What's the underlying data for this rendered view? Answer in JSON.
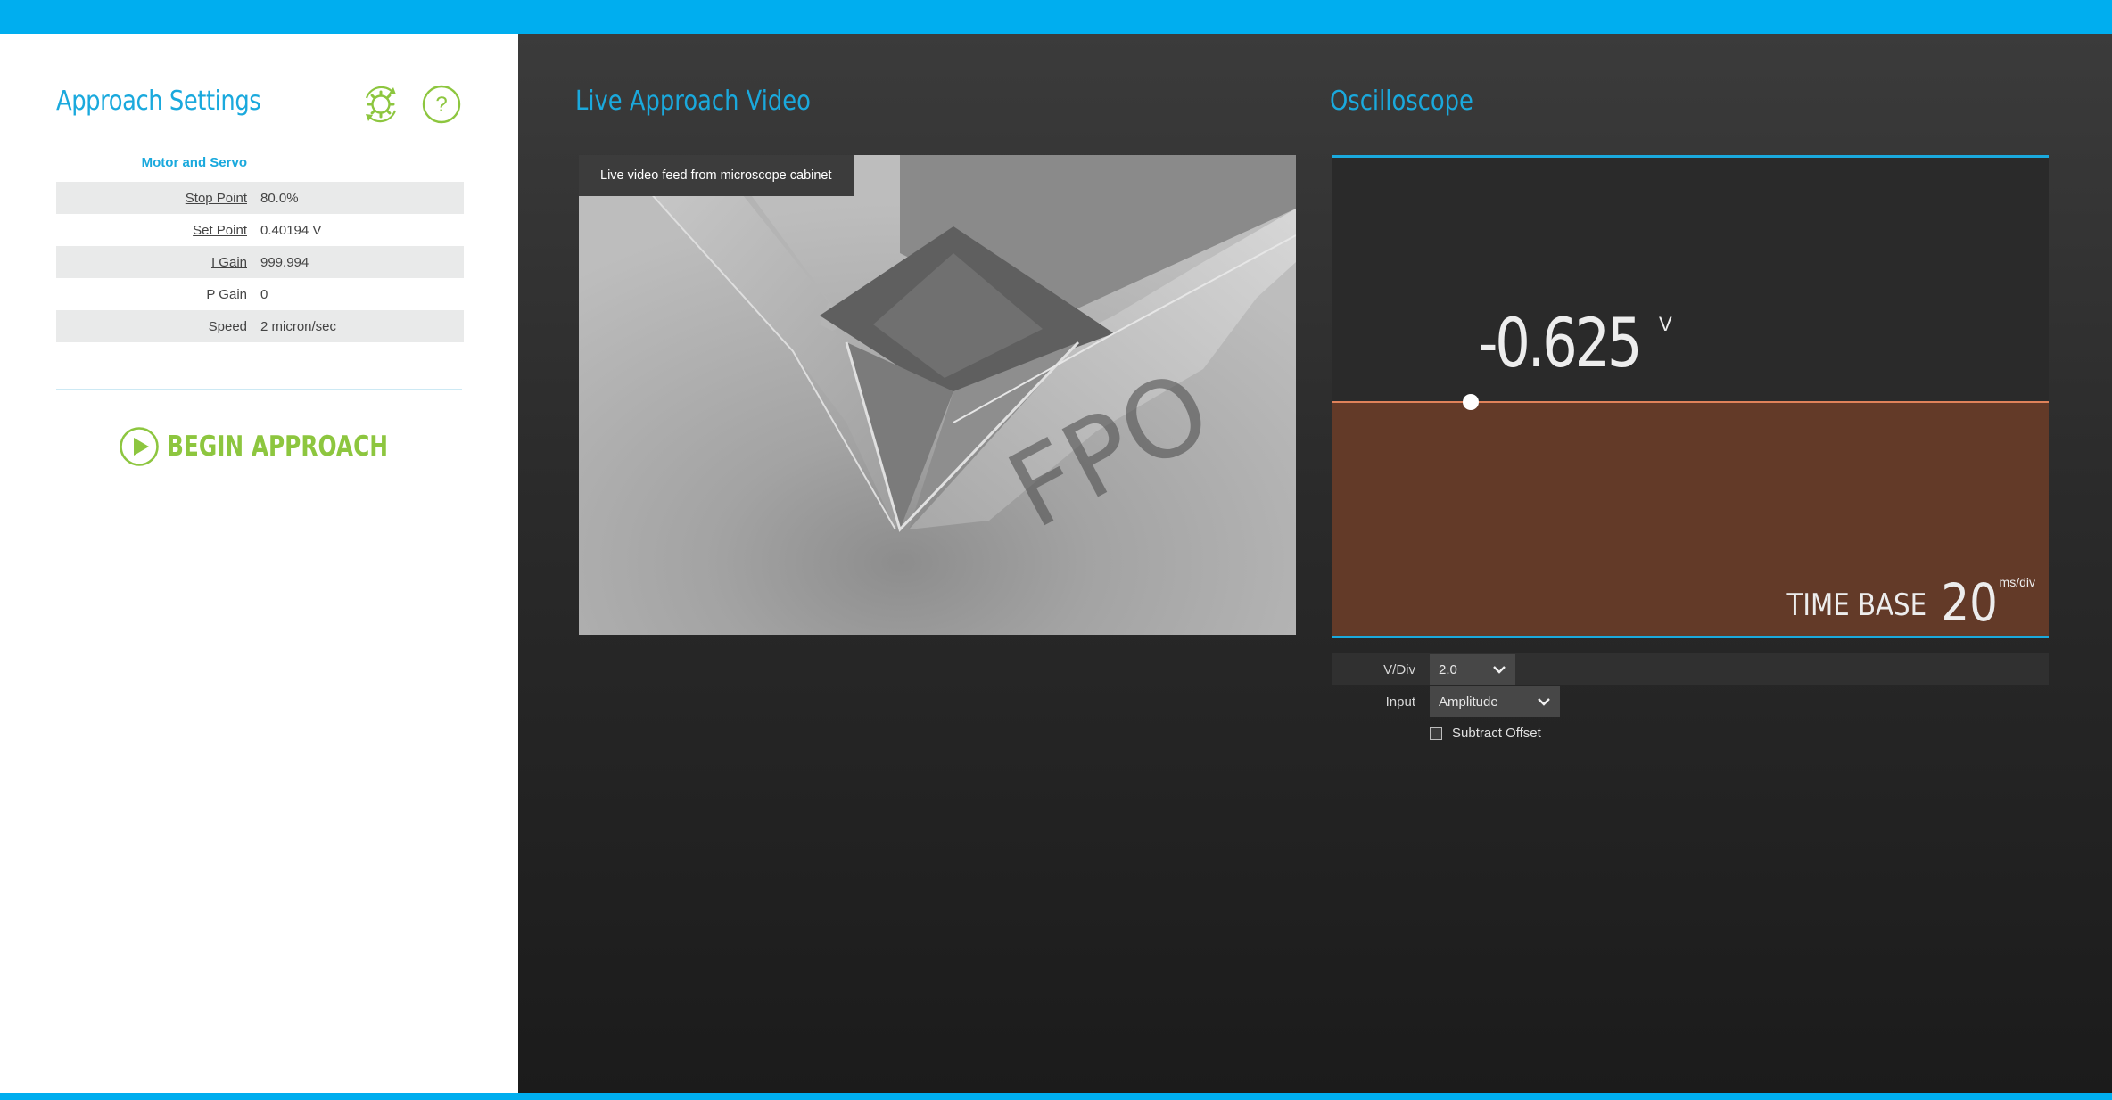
{
  "colors": {
    "accent": "#00aeef",
    "title_blue": "#1aa9dd",
    "action_green": "#8dc63f",
    "scope_fill": "#633a28",
    "scope_line": "#e0825a"
  },
  "settings_panel": {
    "title": "Approach Settings",
    "icons": [
      "settings-cycle-icon",
      "help-icon"
    ],
    "section_label": "Motor and Servo",
    "rows": [
      {
        "label": "Stop Point",
        "value": "80.0%"
      },
      {
        "label": "Set Point",
        "value": "0.40194 V"
      },
      {
        "label": "I Gain",
        "value": "999.994"
      },
      {
        "label": "P Gain",
        "value": "0"
      },
      {
        "label": "Speed",
        "value": "2 micron/sec"
      }
    ],
    "begin_button_label": "BEGIN APPROACH",
    "begin_icon": "play-circle-icon"
  },
  "video_panel": {
    "title": "Live Approach Video",
    "caption": "Live video feed from microscope cabinet",
    "watermark": "FPO"
  },
  "scope_panel": {
    "title": "Oscilloscope",
    "readout_value": "-0.625",
    "readout_unit": "V",
    "level_fraction": 0.51,
    "timebase_label": "TIME BASE",
    "timebase_value": "20",
    "timebase_unit": "ms/div",
    "vdiv_label": "V/Div",
    "vdiv_value": "2.0",
    "input_label": "Input",
    "input_value": "Amplitude",
    "subtract_offset_label": "Subtract Offset",
    "subtract_offset_checked": false
  }
}
